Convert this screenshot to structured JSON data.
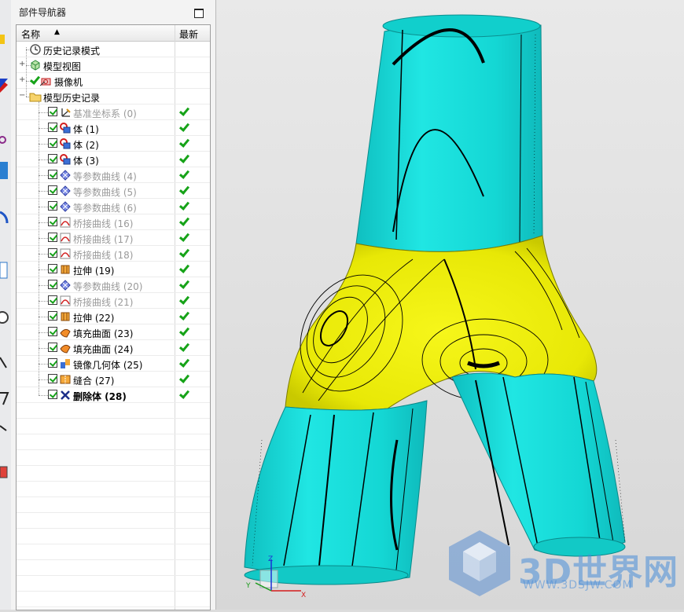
{
  "navigator": {
    "title": "部件导航器",
    "columns": {
      "name": "名称",
      "latest": "最新"
    },
    "items": [
      {
        "label": "历史记录模式",
        "icon": "clock-icon",
        "grey": false,
        "bold": false,
        "checked": false,
        "latest": false,
        "expander": ""
      },
      {
        "label": "模型视图",
        "icon": "model-views-icon",
        "grey": false,
        "bold": false,
        "checked": false,
        "latest": false,
        "expander": "+"
      },
      {
        "label": "摄像机",
        "icon": "camera-icon",
        "grey": false,
        "bold": false,
        "checked": false,
        "latest": false,
        "expander": "+"
      },
      {
        "label": "模型历史记录",
        "icon": "folder-icon",
        "grey": false,
        "bold": false,
        "checked": false,
        "latest": false,
        "expander": "−"
      },
      {
        "label": "基准坐标系 (0)",
        "icon": "datum-csys-icon",
        "grey": true,
        "bold": false,
        "checked": true,
        "latest": true
      },
      {
        "label": "体 (1)",
        "icon": "body-icon",
        "grey": false,
        "bold": false,
        "checked": true,
        "latest": true
      },
      {
        "label": "体 (2)",
        "icon": "body-icon",
        "grey": false,
        "bold": false,
        "checked": true,
        "latest": true
      },
      {
        "label": "体 (3)",
        "icon": "body-icon",
        "grey": false,
        "bold": false,
        "checked": true,
        "latest": true
      },
      {
        "label": "等参数曲线 (4)",
        "icon": "isoparametric-curve-icon",
        "grey": true,
        "bold": false,
        "checked": true,
        "latest": true
      },
      {
        "label": "等参数曲线 (5)",
        "icon": "isoparametric-curve-icon",
        "grey": true,
        "bold": false,
        "checked": true,
        "latest": true
      },
      {
        "label": "等参数曲线 (6)",
        "icon": "isoparametric-curve-icon",
        "grey": true,
        "bold": false,
        "checked": true,
        "latest": true
      },
      {
        "label": "桥接曲线 (16)",
        "icon": "bridge-curve-icon",
        "grey": true,
        "bold": false,
        "checked": true,
        "latest": true
      },
      {
        "label": "桥接曲线 (17)",
        "icon": "bridge-curve-icon",
        "grey": true,
        "bold": false,
        "checked": true,
        "latest": true
      },
      {
        "label": "桥接曲线 (18)",
        "icon": "bridge-curve-icon",
        "grey": true,
        "bold": false,
        "checked": true,
        "latest": true
      },
      {
        "label": "拉伸 (19)",
        "icon": "extrude-icon",
        "grey": false,
        "bold": false,
        "checked": true,
        "latest": true
      },
      {
        "label": "等参数曲线 (20)",
        "icon": "isoparametric-curve-icon",
        "grey": true,
        "bold": false,
        "checked": true,
        "latest": true
      },
      {
        "label": "桥接曲线 (21)",
        "icon": "bridge-curve-icon",
        "grey": true,
        "bold": false,
        "checked": true,
        "latest": true
      },
      {
        "label": "拉伸 (22)",
        "icon": "extrude-icon",
        "grey": false,
        "bold": false,
        "checked": true,
        "latest": true
      },
      {
        "label": "填充曲面 (23)",
        "icon": "fill-surface-icon",
        "grey": false,
        "bold": false,
        "checked": true,
        "latest": true
      },
      {
        "label": "填充曲面 (24)",
        "icon": "fill-surface-icon",
        "grey": false,
        "bold": false,
        "checked": true,
        "latest": true
      },
      {
        "label": "镜像几何体 (25)",
        "icon": "mirror-geometry-icon",
        "grey": false,
        "bold": false,
        "checked": true,
        "latest": true
      },
      {
        "label": "缝合 (27)",
        "icon": "sew-icon",
        "grey": false,
        "bold": false,
        "checked": true,
        "latest": true
      },
      {
        "label": "删除体 (28)",
        "icon": "delete-body-icon",
        "grey": false,
        "bold": true,
        "checked": true,
        "latest": true
      }
    ]
  },
  "viewport": {
    "watermark_text": "3D世界网",
    "watermark_url": "WWW.3DSJW.COM",
    "triad_labels": {
      "x": "X",
      "y": "Y",
      "z": "Z"
    },
    "colors": {
      "cyan": "#16d9d6",
      "yellow": "#f0f00a",
      "background": "#e2e2e2"
    }
  }
}
